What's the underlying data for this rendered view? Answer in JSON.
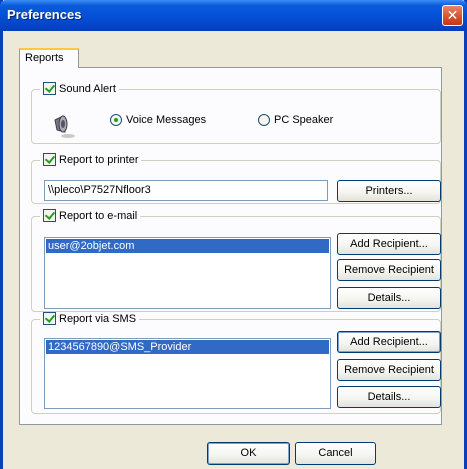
{
  "window": {
    "title": "Preferences",
    "close_glyph": "✕"
  },
  "tabs": [
    {
      "label": "Reports"
    }
  ],
  "sound_alert": {
    "label": "Sound Alert",
    "options": [
      {
        "label": "Voice Messages",
        "selected": true
      },
      {
        "label": "PC Speaker",
        "selected": false
      }
    ],
    "icon": "speaker-icon"
  },
  "printer": {
    "label": "Report to printer",
    "value": "\\\\pleco\\P7527Nfloor3",
    "button": "Printers..."
  },
  "email": {
    "label": "Report to e-mail",
    "items": [
      "user@2objet.com"
    ],
    "buttons": {
      "add": "Add Recipient...",
      "remove": "Remove Recipient",
      "details": "Details..."
    }
  },
  "sms": {
    "label": "Report via SMS",
    "items": [
      "1234567890@SMS_Provider"
    ],
    "buttons": {
      "add": "Add Recipient...",
      "remove": "Remove Recipient",
      "details": "Details..."
    }
  },
  "footer": {
    "ok": "OK",
    "cancel": "Cancel"
  },
  "colors": {
    "titlebar": "#0550d8",
    "selection": "#316ac5",
    "check": "#21a121",
    "close": "#d4502b"
  }
}
